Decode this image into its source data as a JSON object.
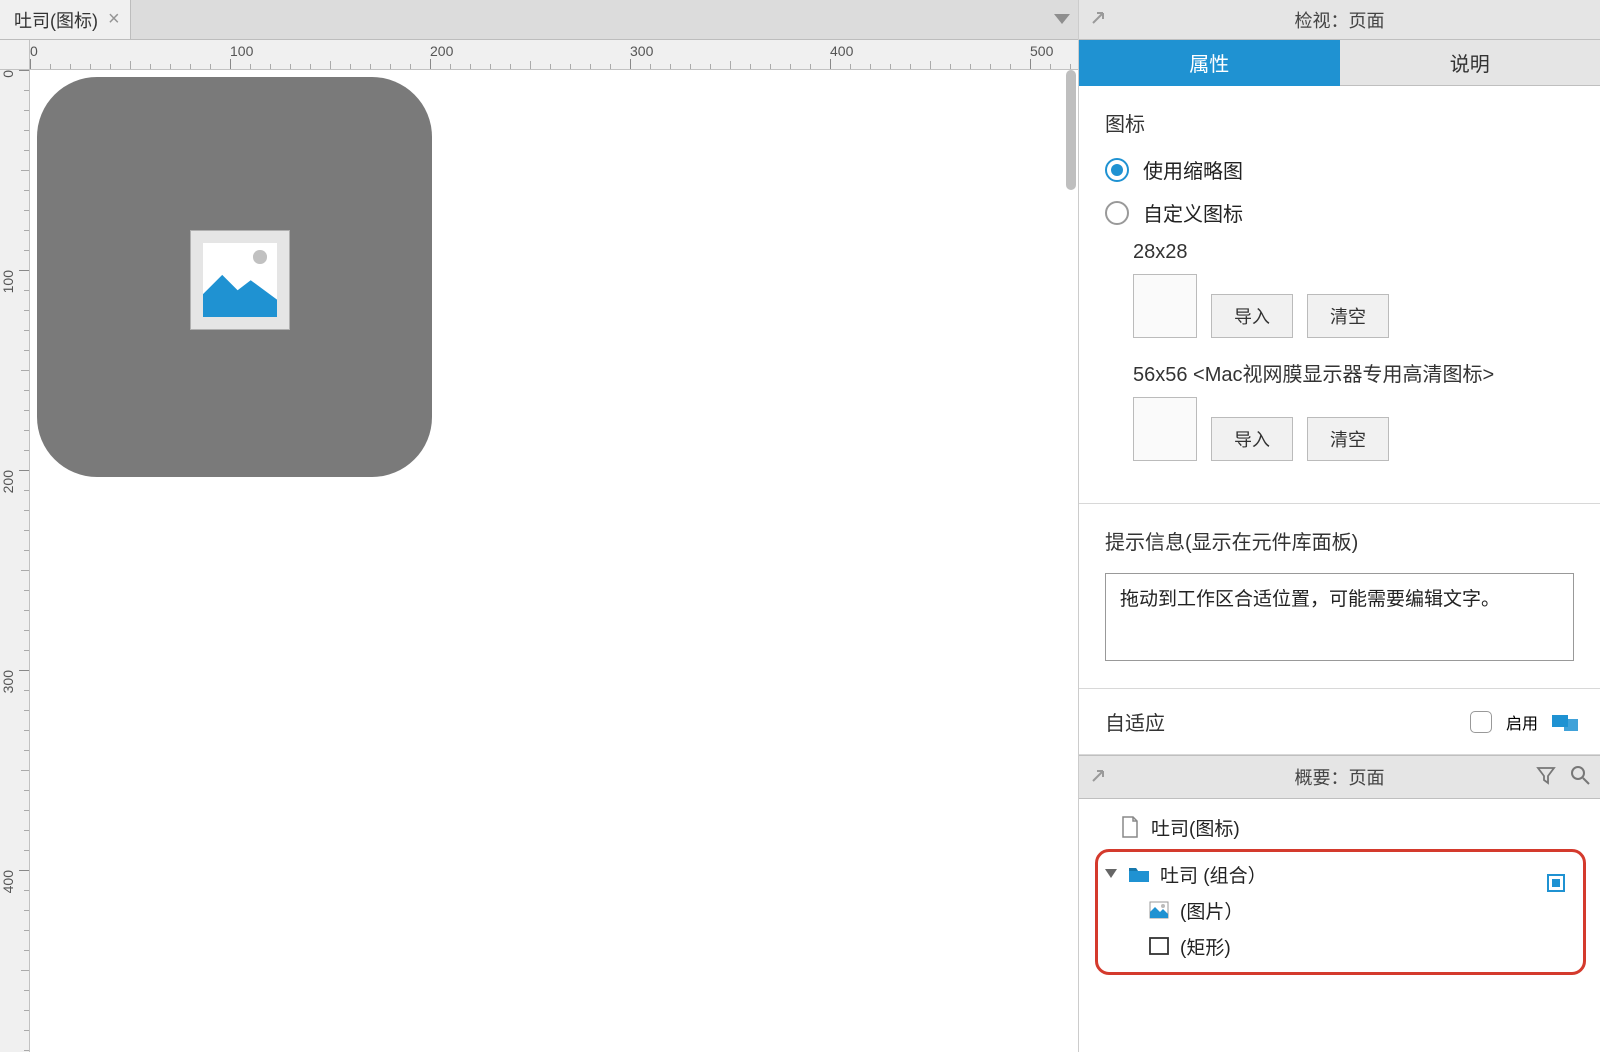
{
  "tab": {
    "title": "吐司(图标)"
  },
  "ruler": {
    "h_labels": [
      "0",
      "100",
      "200",
      "300",
      "400",
      "500"
    ],
    "v_labels": [
      "0",
      "100",
      "200",
      "300",
      "400"
    ]
  },
  "inspector": {
    "title": "检视：页面",
    "tabs": {
      "properties": "属性",
      "notes": "说明",
      "active": "properties"
    },
    "icon_section": {
      "title": "图标",
      "use_thumbnail": "使用缩略图",
      "custom_icon": "自定义图标",
      "size28_label": "28x28",
      "size56_label": "56x56 <Mac视网膜显示器专用高清图标>",
      "import_btn": "导入",
      "clear_btn": "清空",
      "selected": "use_thumbnail"
    },
    "tooltip_section": {
      "title": "提示信息(显示在元件库面板)",
      "text": "拖动到工作区合适位置，可能需要编辑文字。"
    },
    "adaptive": {
      "label": "自适应",
      "enable": "启用"
    }
  },
  "outline": {
    "title": "概要：页面",
    "page": "吐司(图标)",
    "group": "吐司 (组合）",
    "image": "(图片）",
    "rect": "(矩形)"
  },
  "colors": {
    "accent": "#1f92d2",
    "highlight": "#d43a2d"
  }
}
